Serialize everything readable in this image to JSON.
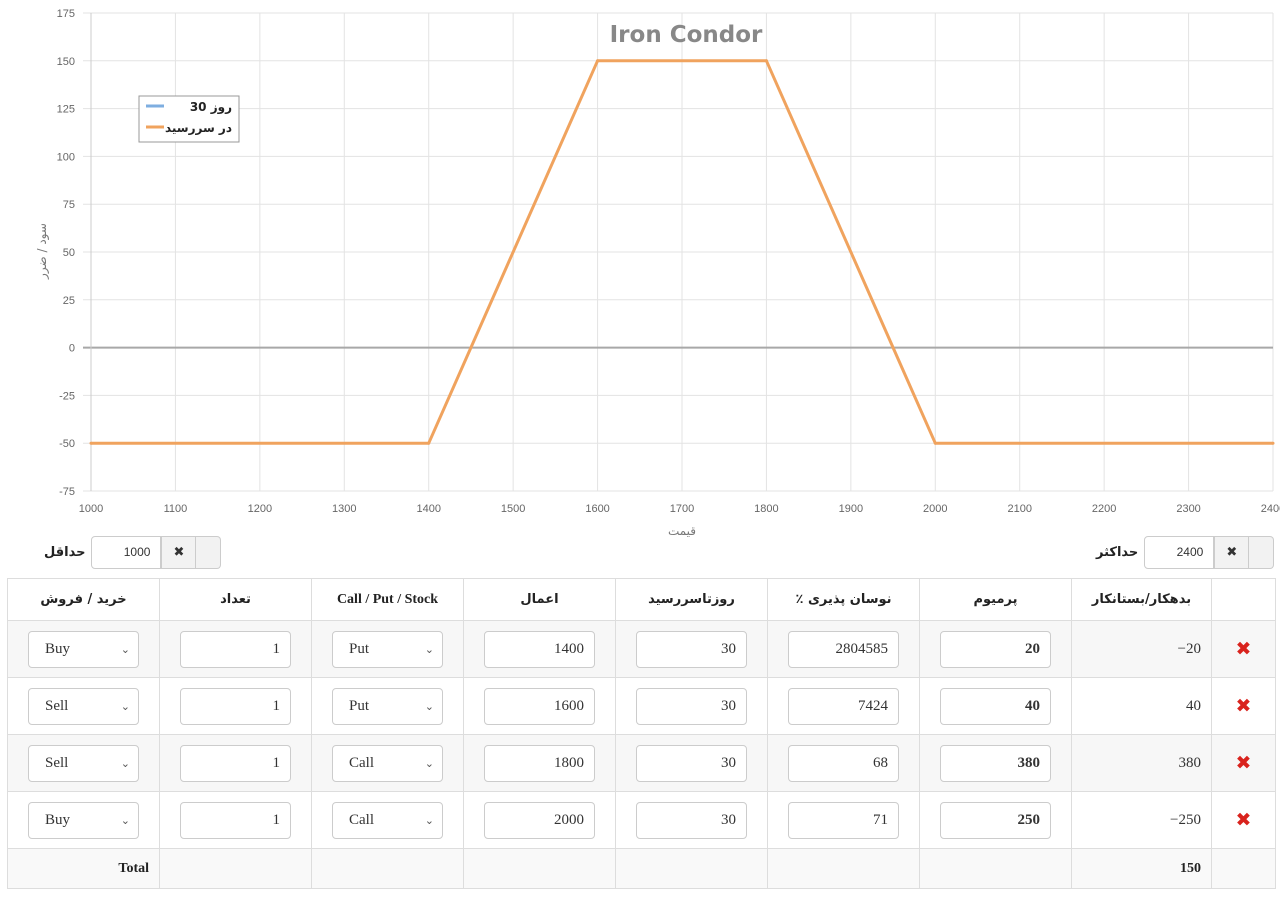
{
  "chart_data": {
    "type": "line",
    "title": "Iron Condor",
    "xlabel": "قیمت",
    "ylabel": "سود / ضرر",
    "xlim": [
      1000,
      2400
    ],
    "ylim": [
      -75,
      175
    ],
    "x_ticks": [
      1000,
      1100,
      1200,
      1300,
      1400,
      1500,
      1600,
      1700,
      1800,
      1900,
      2000,
      2100,
      2200,
      2300,
      2400
    ],
    "y_ticks": [
      -75,
      -50,
      -25,
      0,
      25,
      50,
      75,
      100,
      125,
      150,
      175
    ],
    "grid": true,
    "legend_position": "top-left",
    "series": [
      {
        "name": "30 روز",
        "color": "#7eaee0",
        "x": [],
        "y": []
      },
      {
        "name": "در سررسید",
        "color": "#f0a35e",
        "x": [
          1000,
          1400,
          1600,
          1800,
          2000,
          2400
        ],
        "y": [
          -50,
          -50,
          150,
          150,
          -50,
          -50
        ]
      }
    ]
  },
  "range": {
    "min_label": "حداقل",
    "min_value": "1000",
    "max_label": "حداکثر",
    "max_value": "2400",
    "clear_icon": "✖"
  },
  "table": {
    "headers": {
      "buy_sell": "خرید / فروش",
      "quantity": "تعداد",
      "type": "Call / Put / Stock",
      "strike": "اعمال",
      "days": "روزتاسررسید",
      "iv": "٪ نوسان پذیری",
      "premium": "پرمیوم",
      "debit_credit": "بدهکار/بستانکار"
    },
    "rows": [
      {
        "action": "Buy",
        "qty": "1",
        "type": "Put",
        "strike": "1400",
        "days": "30",
        "iv": "2804585",
        "premium": "20",
        "credit": "−20"
      },
      {
        "action": "Sell",
        "qty": "1",
        "type": "Put",
        "strike": "1600",
        "days": "30",
        "iv": "7424",
        "premium": "40",
        "credit": "40"
      },
      {
        "action": "Sell",
        "qty": "1",
        "type": "Call",
        "strike": "1800",
        "days": "30",
        "iv": "68",
        "premium": "380",
        "credit": "380"
      },
      {
        "action": "Buy",
        "qty": "1",
        "type": "Call",
        "strike": "2000",
        "days": "30",
        "iv": "71",
        "premium": "250",
        "credit": "−250"
      }
    ],
    "delete_icon": "✖",
    "total_label": "Total",
    "total_value": "150"
  }
}
